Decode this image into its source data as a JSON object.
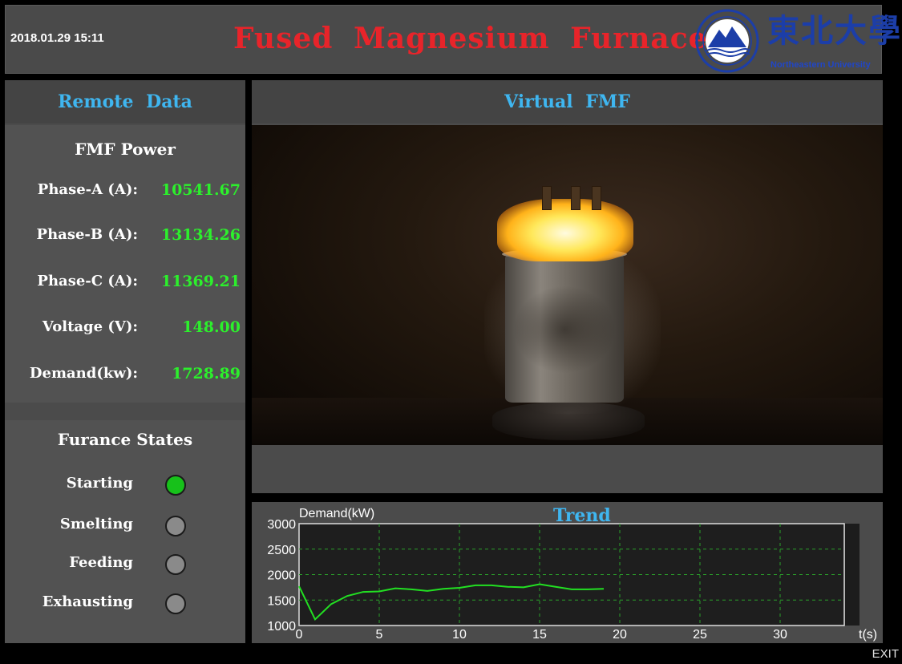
{
  "header": {
    "datetime": "2018.01.29 15:11",
    "title": "Fused Magnesium Furnace",
    "logo_cn": "東北大學",
    "logo_en": "Northeastern University"
  },
  "remote": {
    "title": "Remote Data",
    "power": {
      "title": "FMF Power",
      "rows": [
        {
          "label": "Phase-A (A):",
          "value": "10541.67"
        },
        {
          "label": "Phase-B (A):",
          "value": "13134.26"
        },
        {
          "label": "Phase-C (A):",
          "value": "11369.21"
        },
        {
          "label": "Voltage (V):",
          "value": "148.00"
        },
        {
          "label": "Demand(kw):",
          "value": "1728.89"
        }
      ]
    },
    "states": {
      "title": "Furance States",
      "items": [
        {
          "label": "Starting",
          "active": true
        },
        {
          "label": "Smelting",
          "active": false
        },
        {
          "label": "Feeding",
          "active": false
        },
        {
          "label": "Exhausting",
          "active": false
        }
      ]
    }
  },
  "virtual": {
    "title": "Virtual FMF"
  },
  "trend": {
    "title": "Trend"
  },
  "exit_label": "EXIT",
  "colors": {
    "title_red": "#e8242a",
    "accent_blue": "#3fb6f0",
    "value_green": "#2cf02c",
    "led_on": "#17c11a",
    "led_off": "#8a8a8a",
    "trend_line": "#22e022",
    "grid": "#2aa02a"
  },
  "chart_data": {
    "type": "line",
    "title": "Trend",
    "ylabel": "Demand(kW)",
    "xlabel": "t(s)",
    "xlim": [
      0,
      34
    ],
    "ylim": [
      1000,
      3000
    ],
    "xticks": [
      0,
      5,
      10,
      15,
      20,
      25,
      30
    ],
    "yticks": [
      1000,
      1500,
      2000,
      2500,
      3000
    ],
    "grid": true,
    "x": [
      0,
      1,
      2,
      3,
      4,
      5,
      6,
      7,
      8,
      9,
      10,
      11,
      12,
      13,
      14,
      15,
      16,
      17,
      18,
      19
    ],
    "series": [
      {
        "values": [
          1770,
          1120,
          1420,
          1580,
          1660,
          1670,
          1730,
          1710,
          1680,
          1720,
          1740,
          1790,
          1790,
          1760,
          1750,
          1810,
          1760,
          1710,
          1710,
          1720
        ]
      }
    ]
  }
}
